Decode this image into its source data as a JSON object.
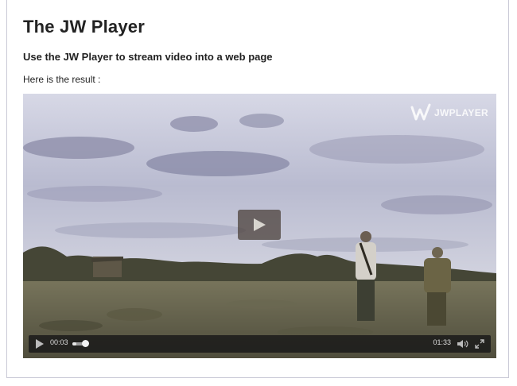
{
  "page": {
    "title": "The JW Player",
    "subtitle": "Use the JW Player to stream video into a web page",
    "result_text": "Here is the result :"
  },
  "player": {
    "logo_text": "JWPLAYER",
    "elapsed": "00:03",
    "duration": "01:33",
    "progress_fraction": 0.034,
    "state": "paused",
    "accent_color": "#e6e6e6",
    "icons": {
      "play_overlay": "play-icon",
      "control_play": "play-icon",
      "volume": "volume-icon",
      "fullscreen": "fullscreen-icon",
      "logo": "jwplayer-logo"
    }
  }
}
